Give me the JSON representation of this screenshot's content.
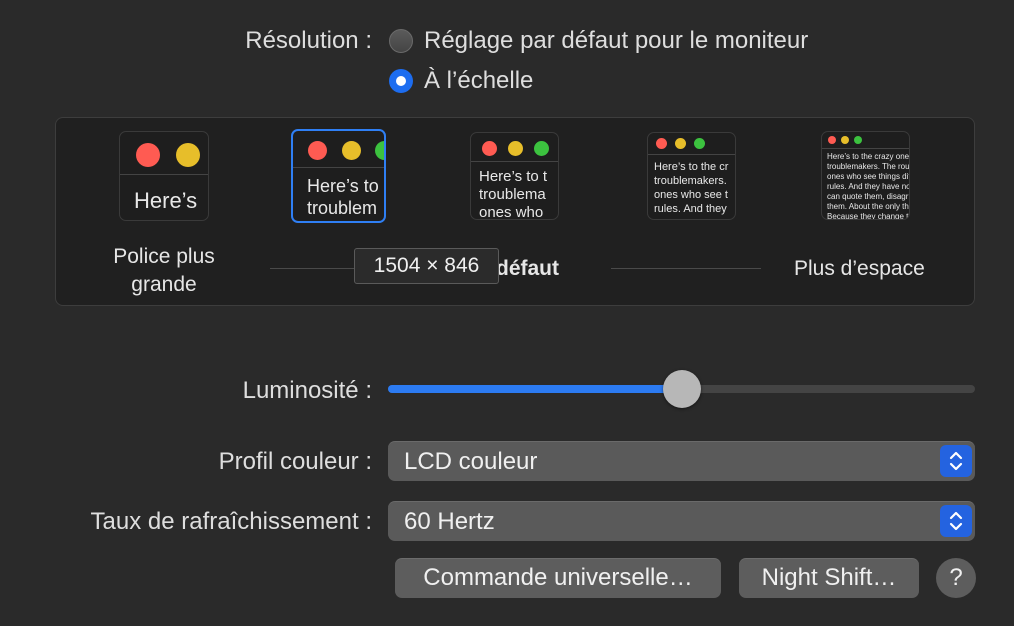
{
  "resolution": {
    "label": "Résolution :",
    "option_default": "Réglage par défaut pour le moniteur",
    "option_scaled": "À l’échelle",
    "selected": "option_scaled"
  },
  "scaled_options": {
    "thumbnails": [
      {
        "text": "Here’s"
      },
      {
        "text": "Here’s to\ntroublem"
      },
      {
        "text": "Here’s to t\ntroublema\nones who"
      },
      {
        "text": "Here’s to the cr\ntroublemakers.\nones who see t\nrules. And they"
      },
      {
        "text": "Here’s to the crazy ones\ntroublemakers. The rou\nones who see things dif\nrules. And they have no\ncan quote them, disagr\nthem. About the only th\nBecause they change th"
      }
    ],
    "selected_index": 1,
    "label_larger_text": "Police plus grande",
    "label_default": "défaut",
    "label_more_space": "Plus d’espace",
    "tooltip": "1504 × 846"
  },
  "brightness": {
    "label": "Luminosité :",
    "level": 0.5
  },
  "color_profile": {
    "label": "Profil couleur :",
    "value": "LCD couleur"
  },
  "refresh_rate": {
    "label": "Taux de rafraîchissement :",
    "value": "60 Hertz"
  },
  "buttons": {
    "universal_control": "Commande universelle…",
    "night_shift": "Night Shift…",
    "help": "?"
  },
  "colors": {
    "accent": "#2c7bf2",
    "traffic_red": "#ff5b52",
    "traffic_yellow": "#e7be2a",
    "traffic_green": "#3cc23f"
  }
}
